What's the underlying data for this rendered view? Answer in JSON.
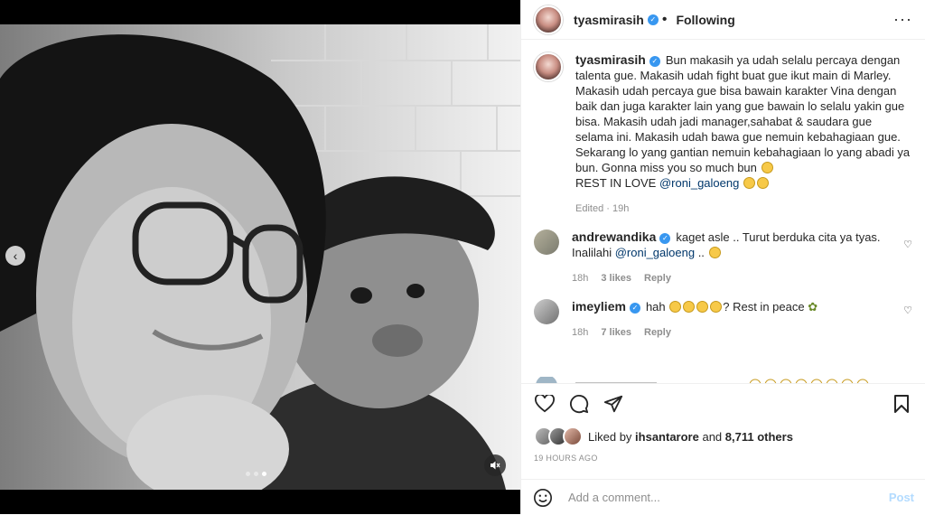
{
  "post": {
    "author": "tyasmirasih",
    "follow_status": "Following",
    "more_icon": "more-horizontal-icon"
  },
  "caption": {
    "username": "tyasmirasih",
    "text": "Bun makasih ya udah selalu percaya dengan talenta gue. Makasih udah fight buat gue ikut main di Marley. Makasih udah percaya gue bisa bawain karakter Vina dengan baik dan juga karakter lain yang gue bawain lo selalu yakin gue bisa. Makasih udah jadi manager,sahabat & saudara gue selama ini. Makasih udah bawa gue nemuin kebahagiaan gue. Sekarang lo yang gantian nemuin kebahagiaan lo yang abadi ya bun. Gonna miss you so much bun",
    "line2_prefix": "REST IN LOVE ",
    "mention": "@roni_galoeng",
    "edited": "Edited · 19h"
  },
  "comments": [
    {
      "username": "andrewandika",
      "text": "kaget asle .. Turut berduka cita ya tyas. Inalilahi ",
      "mention": "@roni_galoeng",
      "suffix": " ..",
      "time": "18h",
      "likes": "3 likes",
      "reply": "Reply"
    },
    {
      "username": "imeyliem",
      "text": "hah ",
      "suffix": "? Rest in peace",
      "time": "18h",
      "likes": "7 likes",
      "reply": "Reply"
    }
  ],
  "liked_by": {
    "prefix": "Liked by ",
    "user": "ihsantarore",
    "middle": " and ",
    "others": "8,711 others"
  },
  "timestamp": "19 HOURS AGO",
  "comment_box": {
    "placeholder": "Add a comment...",
    "post_label": "Post"
  },
  "colors": {
    "verified": "#3897f0",
    "post_button_disabled": "#b3dbff",
    "mention": "#00376b"
  }
}
